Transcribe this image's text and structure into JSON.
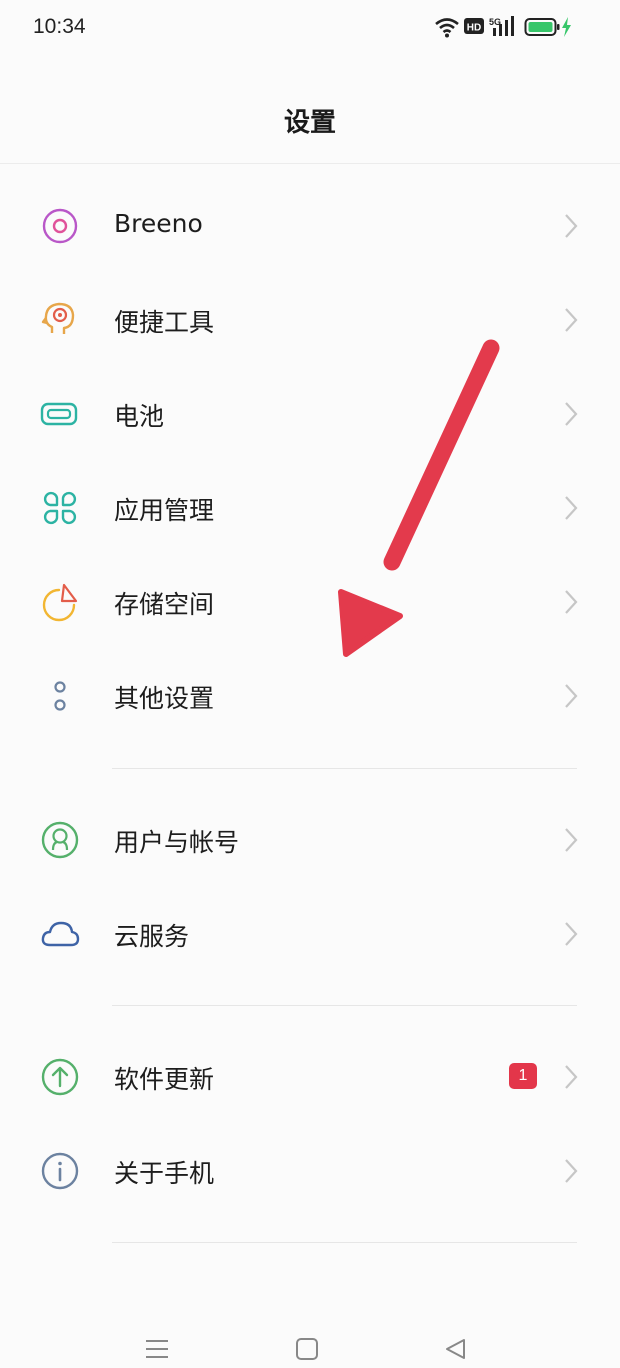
{
  "status_bar": {
    "time": "10:34",
    "icons": [
      "wifi-icon",
      "hd-icon",
      "signal-5g-icon",
      "battery-charging-icon"
    ],
    "hd_text": "HD",
    "network_text": "5G"
  },
  "header": {
    "title": "设置"
  },
  "sections": [
    {
      "items": [
        {
          "label": "Breeno",
          "icon": "breeno-icon",
          "color": "#b957c8"
        },
        {
          "label": "便捷工具",
          "icon": "head-gear-icon",
          "color": "#e7a64a"
        },
        {
          "label": "电池",
          "icon": "battery-icon",
          "color": "#2cb3a3"
        },
        {
          "label": "应用管理",
          "icon": "apps-grid-icon",
          "color": "#2cb3a3"
        },
        {
          "label": "存储空间",
          "icon": "pie-chart-icon",
          "color": "#f2b632"
        },
        {
          "label": "其他设置",
          "icon": "more-dots-icon",
          "color": "#6c82a0"
        }
      ]
    },
    {
      "items": [
        {
          "label": "用户与帐号",
          "icon": "user-account-icon",
          "color": "#55b06b"
        },
        {
          "label": "云服务",
          "icon": "cloud-icon",
          "color": "#3e63a6"
        }
      ]
    },
    {
      "items": [
        {
          "label": "软件更新",
          "icon": "update-arrow-icon",
          "color": "#55b06b",
          "badge": "1"
        },
        {
          "label": "关于手机",
          "icon": "info-icon",
          "color": "#6c82a0"
        }
      ]
    }
  ],
  "annotation": {
    "icon": "red-arrow-annotation",
    "color": "#e33a4c"
  },
  "nav_bar": {
    "icons": [
      "menu-icon",
      "home-icon",
      "back-icon"
    ]
  }
}
